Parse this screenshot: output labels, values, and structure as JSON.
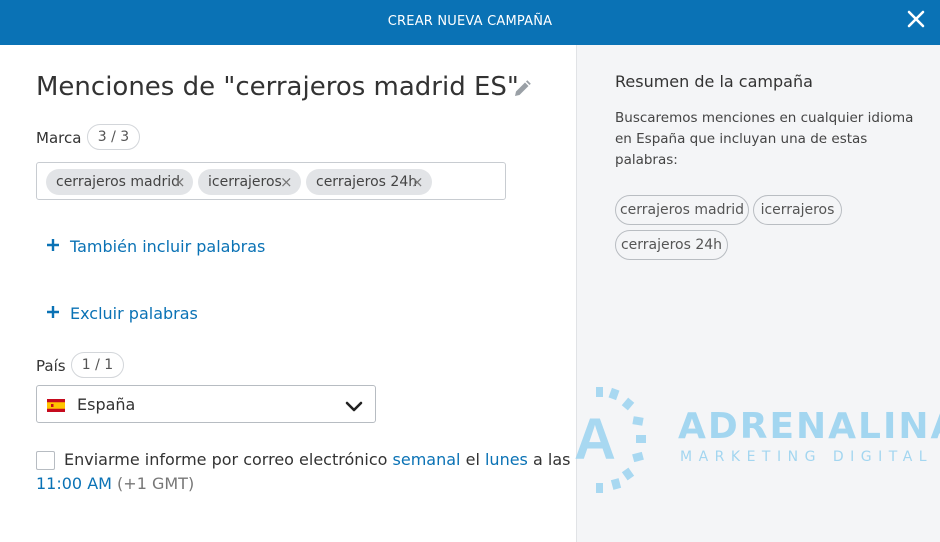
{
  "header": {
    "title": "CREAR NUEVA CAMPAÑA",
    "close_icon": "close-icon"
  },
  "campaign": {
    "title": "Menciones de \"cerrajeros madrid ES\"",
    "edit_icon": "pencil-icon"
  },
  "brand": {
    "label": "Marca",
    "counter": "3 / 3",
    "tags": [
      "cerrajeros madrid",
      "icerrajeros",
      "cerrajeros 24h"
    ],
    "remove_symbol": "×"
  },
  "include_link": "También incluir palabras",
  "exclude_link": "Excluir palabras",
  "country": {
    "label": "País",
    "counter": "1 / 1",
    "selected": "España",
    "flag_icon": "spain-flag-icon"
  },
  "email_report": {
    "prefix": "Enviarme informe por correo electrónico",
    "frequency": "semanal",
    "mid": "el",
    "day": "lunes",
    "suffix": "a las",
    "time": "11:00 AM",
    "timezone": "(+1 GMT)",
    "checked": false
  },
  "summary": {
    "title": "Resumen de la campaña",
    "description": "Buscaremos menciones en cualquier idioma en España que incluyan una de estas palabras:",
    "tags": [
      "cerrajeros madrid",
      "icerrajeros",
      "cerrajeros 24h"
    ]
  },
  "watermark": {
    "name": "ADRENALINA",
    "tagline": "MARKETING DIGITAL",
    "letter": "A"
  },
  "colors": {
    "primary": "#0a72b5",
    "panel": "#f4f5f7",
    "watermark": "#9bd3f0"
  }
}
